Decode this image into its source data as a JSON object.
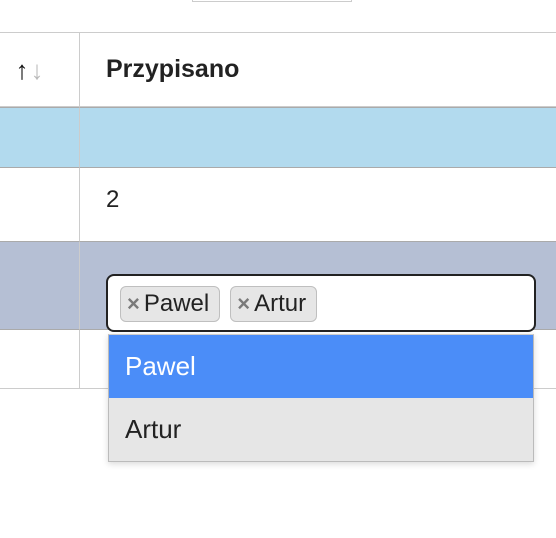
{
  "header": {
    "sort_icon": "sort",
    "column_label": "Przypisano"
  },
  "rows": {
    "row2_value": "2"
  },
  "tag_editor": {
    "tags": [
      {
        "label": "Pawel"
      },
      {
        "label": "Artur"
      }
    ]
  },
  "dropdown": {
    "options": [
      {
        "label": "Pawel",
        "selected": true
      },
      {
        "label": "Artur",
        "selected": false
      }
    ]
  }
}
